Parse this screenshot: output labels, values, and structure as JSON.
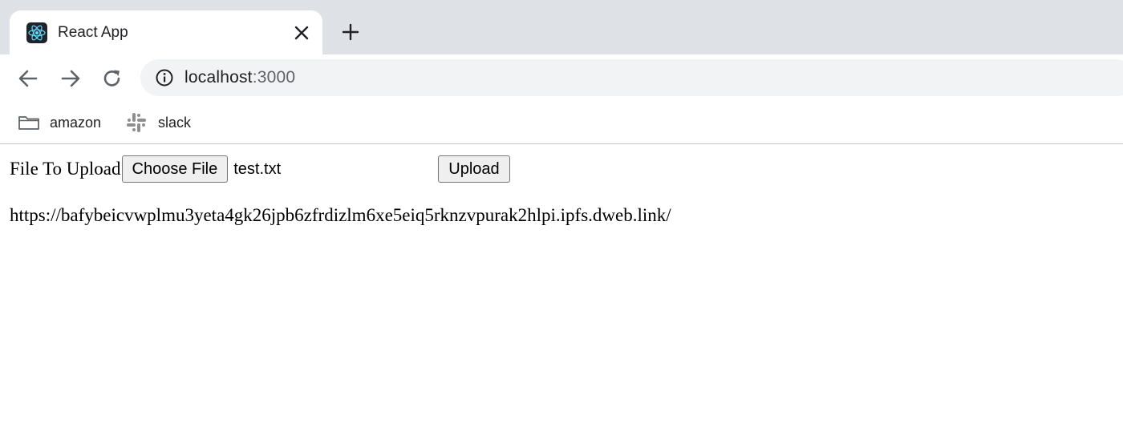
{
  "browser": {
    "tab": {
      "title": "React App",
      "favicon": "react-logo-icon"
    },
    "new_tab_icon": "plus-icon",
    "toolbar": {
      "back_icon": "arrow-left-icon",
      "forward_icon": "arrow-right-icon",
      "reload_icon": "reload-icon",
      "site_info_icon": "info-icon",
      "url_host": "localhost",
      "url_port": ":3000"
    },
    "bookmarks": [
      {
        "label": "amazon",
        "icon": "folder-icon"
      },
      {
        "label": "slack",
        "icon": "slack-logo-icon"
      }
    ]
  },
  "page": {
    "upload_label": "File To Upload",
    "choose_file_label": "Choose File",
    "selected_file": "test.txt",
    "upload_button_label": "Upload",
    "result_url": "https://bafybeicvwplmu3yeta4gk26jpb6zfrdizlm6xe5eiq5rknzvpurak2hlpi.ipfs.dweb.link/"
  },
  "colors": {
    "tabstrip_bg": "#dee1e6",
    "omnibox_bg": "#f1f3f4",
    "icon_gray": "#5f6368",
    "text_dark": "#202124",
    "react_blue": "#61dafb"
  }
}
